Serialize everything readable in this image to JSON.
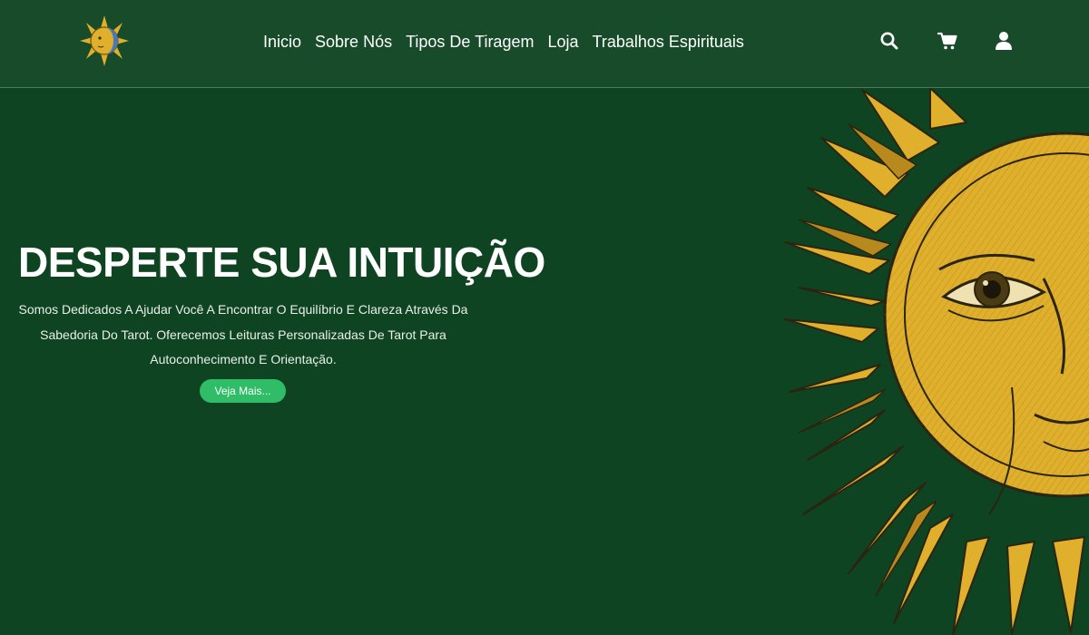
{
  "nav": {
    "items": [
      {
        "label": "Inicio"
      },
      {
        "label": "Sobre Nós"
      },
      {
        "label": "Tipos De Tiragem"
      },
      {
        "label": "Loja"
      },
      {
        "label": "Trabalhos Espirituais"
      }
    ]
  },
  "header_icons": [
    "search-icon",
    "cart-icon",
    "user-icon"
  ],
  "hero": {
    "title": "DESPERTE SUA INTUIÇÃO",
    "lines": [
      "Somos Dedicados A Ajudar Você A Encontrar O Equilíbrio E Clareza Através Da",
      "Sabedoria Do Tarot. Oferecemos Leituras Personalizadas De Tarot Para",
      "Autoconhecimento E Orientação."
    ],
    "cta_label": "Veja Mais..."
  },
  "colors": {
    "header_bg": "#174b2a",
    "hero_bg": "#0f4422",
    "cta": "#2fbd67",
    "sun_gold": "#e0b02c",
    "sun_dark": "#2a2410"
  }
}
